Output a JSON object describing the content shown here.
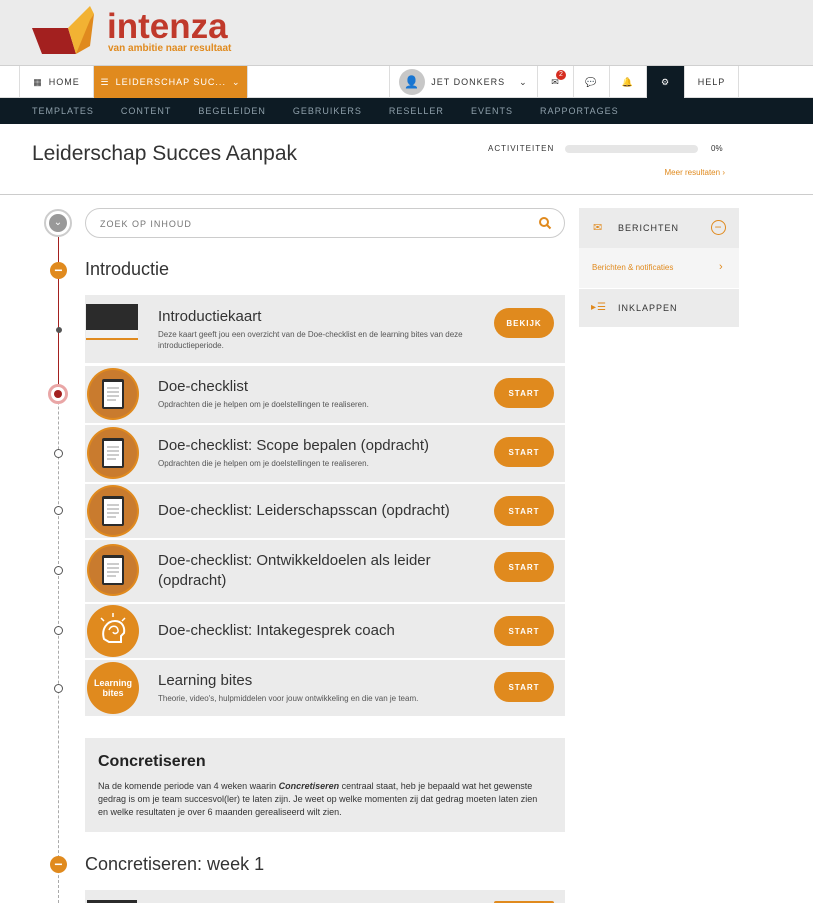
{
  "brand": {
    "name": "intenza",
    "tagline": "van ambitie naar resultaat",
    "colors": {
      "primary": "#e08a1e",
      "accent": "#c0392b",
      "dark": "#0d1b24"
    }
  },
  "nav": {
    "home": "HOME",
    "program": "LEIDERSCHAP SUC...",
    "user": "JET DONKERS",
    "mail_badge": "2",
    "help": "HELP"
  },
  "subnav": [
    "TEMPLATES",
    "CONTENT",
    "BEGELEIDEN",
    "GEBRUIKERS",
    "RESELLER",
    "EVENTS",
    "RAPPORTAGES"
  ],
  "page": {
    "title": "Leiderschap Succes Aanpak",
    "activity_label": "ACTIVITEITEN",
    "activity_pct": "0%",
    "activity_progress": 0,
    "more_results": "Meer resultaten"
  },
  "search": {
    "placeholder": "ZOEK OP INHOUD"
  },
  "sections": [
    {
      "title": "Introductie"
    },
    {
      "title": "Concretiseren: week 1"
    }
  ],
  "items": [
    {
      "title": "Introductiekaart",
      "desc": "Deze kaart geeft jou een overzicht van de Doe-checklist en de learning bites van deze introductieperiode.",
      "button": "BEKIJK",
      "icon": "thumbnail"
    },
    {
      "title": "Doe-checklist",
      "desc": "Opdrachten die je helpen om je doelstellingen te realiseren.",
      "button": "START",
      "icon": "clipboard-icon"
    },
    {
      "title": "Doe-checklist: Scope bepalen (opdracht)",
      "desc": "Opdrachten die je helpen om je doelstellingen te realiseren.",
      "button": "START",
      "icon": "clipboard-icon"
    },
    {
      "title": "Doe-checklist: Leiderschapsscan (opdracht)",
      "desc": "",
      "button": "START",
      "icon": "clipboard-icon"
    },
    {
      "title": "Doe-checklist: Ontwikkeldoelen als leider (opdracht)",
      "desc": "",
      "button": "START",
      "icon": "clipboard-icon"
    },
    {
      "title": "Doe-checklist: Intakegesprek coach",
      "desc": "",
      "button": "START",
      "icon": "head-icon"
    },
    {
      "title": "Learning bites",
      "desc": "Theorie, video's, hulpmiddelen voor jouw ontwikkeling en die van je team.",
      "button": "START",
      "icon": "learning-bites-icon",
      "icon_text_1": "Learning",
      "icon_text_2": "bites"
    }
  ],
  "info": {
    "title": "Concretiseren",
    "text_before": "Na de komende periode van 4 weken waarin ",
    "text_em": "Concretiseren",
    "text_after": " centraal staat, heb je bepaald wat het gewenste gedrag is om je team succesvol(ler) te laten zijn. Je weet op welke momenten zij dat gedrag moeten laten zien en welke resultaten je over 6 maanden gerealiseerd wilt zien."
  },
  "side": {
    "messages": "BERICHTEN",
    "notifications": "Berichten & notificaties",
    "collapse": "INKLAPPEN"
  }
}
